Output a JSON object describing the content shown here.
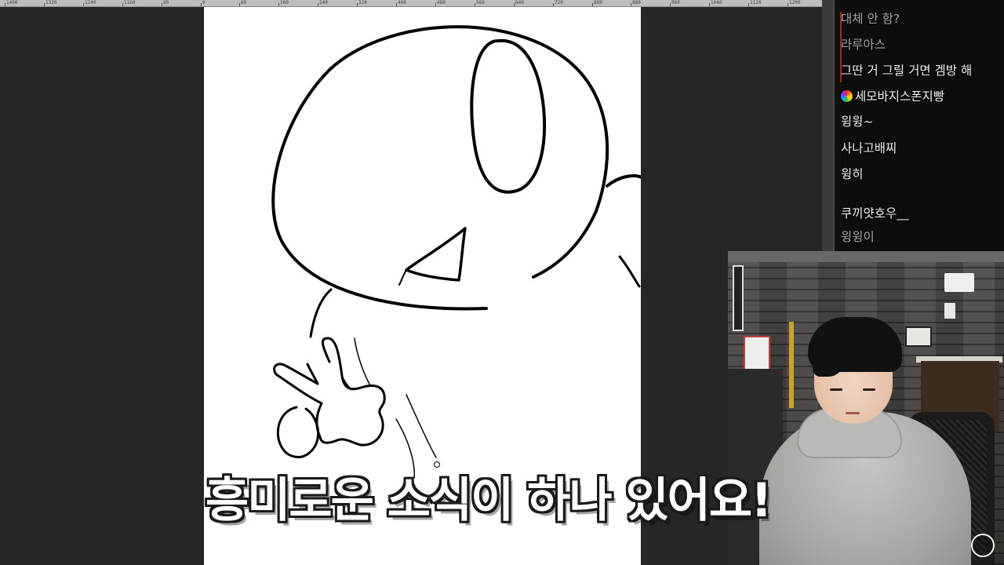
{
  "ruler": {
    "ticks": [
      "1400",
      "1320",
      "1240",
      "1160",
      "80",
      "0",
      "80",
      "160",
      "240",
      "320",
      "400",
      "480",
      "560",
      "640",
      "720",
      "800",
      "880",
      "960",
      "1040",
      "1120",
      "1200"
    ]
  },
  "chat": {
    "messages": [
      {
        "text": "대체 안 함?",
        "style": "dim"
      },
      {
        "text": "라루아스",
        "style": "dim"
      },
      {
        "text": "그딴 거 그릴 거면 겜방 해",
        "style": "normal"
      },
      {
        "text": "세모바지스폰지빵",
        "style": "normal",
        "badge": "rainbow-badge-icon"
      },
      {
        "text": "윙윙~",
        "style": "normal"
      },
      {
        "text": "사나고배찌",
        "style": "normal"
      },
      {
        "text": "윙히",
        "style": "normal"
      },
      {
        "text": "쿠끼얏호우__",
        "style": "normal"
      },
      {
        "text": "윙윙이",
        "style": "dim"
      }
    ]
  },
  "caption": {
    "text": "흥미로운 소식이 하나 있어요!"
  },
  "colors": {
    "workspace": "#262626",
    "canvas": "#ffffff",
    "chat_bg": "#000000",
    "caption_text": "#ffffff",
    "caption_outline": "#1a1a1a"
  }
}
